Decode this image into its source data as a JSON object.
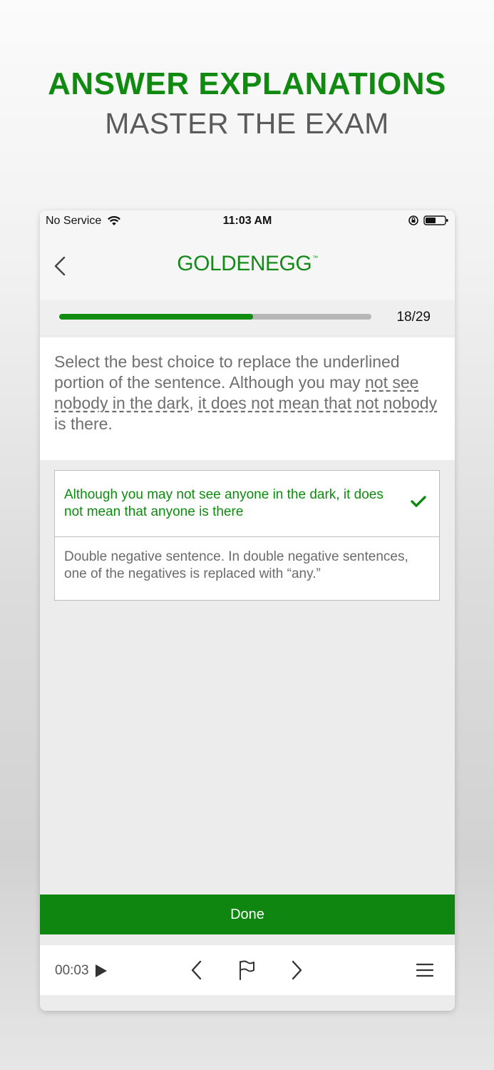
{
  "promo": {
    "title": "ANSWER EXPLANATIONS",
    "subtitle": "MASTER THE EXAM"
  },
  "status_bar": {
    "carrier": "No Service",
    "time": "11:03 AM",
    "icons": [
      "wifi-icon",
      "orientation-lock-icon",
      "battery-icon"
    ]
  },
  "navbar": {
    "back_icon": "chevron-left-icon",
    "logo_part1": "GOLDEN",
    "logo_part2": "EGG",
    "logo_tm": "™"
  },
  "progress": {
    "current": 18,
    "total": 29,
    "label": "18/29",
    "fill_color": "#118c11",
    "track_color": "#b7b7b7"
  },
  "question": {
    "segments": [
      {
        "text": "Select the best choice to replace the underlined portion of the sentence. Although you may ",
        "underline": false
      },
      {
        "text": "not see nobody in the dark",
        "underline": true
      },
      {
        "text": ", ",
        "underline": false
      },
      {
        "text": "it does not mean that not nobody",
        "underline": true
      },
      {
        "text": "  is there.",
        "underline": false
      }
    ]
  },
  "answers": {
    "correct_answer": "Although you may not see anyone in the dark, it does not mean that anyone is there",
    "explanation": "Double negative sentence. In double negative sentences, one of the negatives is replaced with “any.”",
    "correct_icon": "checkmark-icon"
  },
  "done_button": {
    "label": "Done",
    "color": "#0e860f"
  },
  "toolbar": {
    "timer": "00:03",
    "icons": [
      "play-icon",
      "chevron-left-icon",
      "flag-icon",
      "chevron-right-icon",
      "menu-icon"
    ]
  },
  "colors": {
    "brand_green": "#108a10",
    "subtitle_gray": "#5b5b5b"
  }
}
